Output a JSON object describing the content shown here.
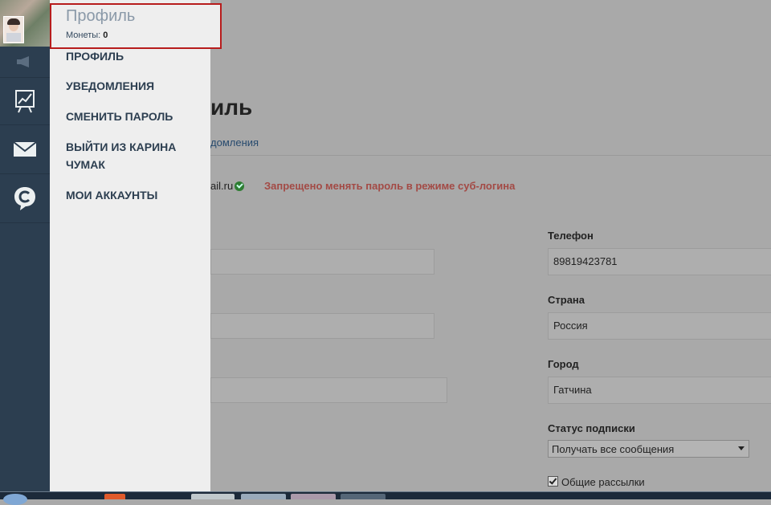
{
  "colors": {
    "rail": "#2c3e50",
    "menu_bg": "#eeeeee",
    "menu_text": "#2c3e50",
    "header_border": "#b71c1c",
    "warning": "#a34a45",
    "overlay_bg": "#a9a9a9"
  },
  "rail": {
    "avatar_icon": "user-avatar",
    "items": [
      {
        "name": "megaphone-icon"
      },
      {
        "name": "chart-icon"
      },
      {
        "name": "mail-icon"
      },
      {
        "name": "chat-c-icon"
      }
    ]
  },
  "menu": {
    "header": {
      "title": "Профиль",
      "coins_label": "Монеты:",
      "coins_value": "0"
    },
    "items": [
      {
        "label": "ПРОФИЛЬ"
      },
      {
        "label": "УВЕДОМЛЕНИЯ"
      },
      {
        "label": "СМЕНИТЬ ПАРОЛЬ"
      },
      {
        "label": "ВЫЙТИ ИЗ КАРИНА ЧУМАК"
      },
      {
        "label": "МОИ АККАУНТЫ"
      }
    ]
  },
  "page": {
    "title_fragment": "иль",
    "subtab_fragment": "домления",
    "email_fragment": "ail.ru",
    "warning": "Запрещено менять пароль в режиме суб-логина",
    "fields": {
      "phone_label": "Телефон",
      "phone_value": "89819423781",
      "country_label": "Страна",
      "country_value": "Россия",
      "city_label": "Город",
      "city_value": "Гатчина",
      "subscription_label": "Статус подписки",
      "subscription_value": "Получать все сообщения",
      "newsletter_label": "Общие рассылки"
    }
  }
}
